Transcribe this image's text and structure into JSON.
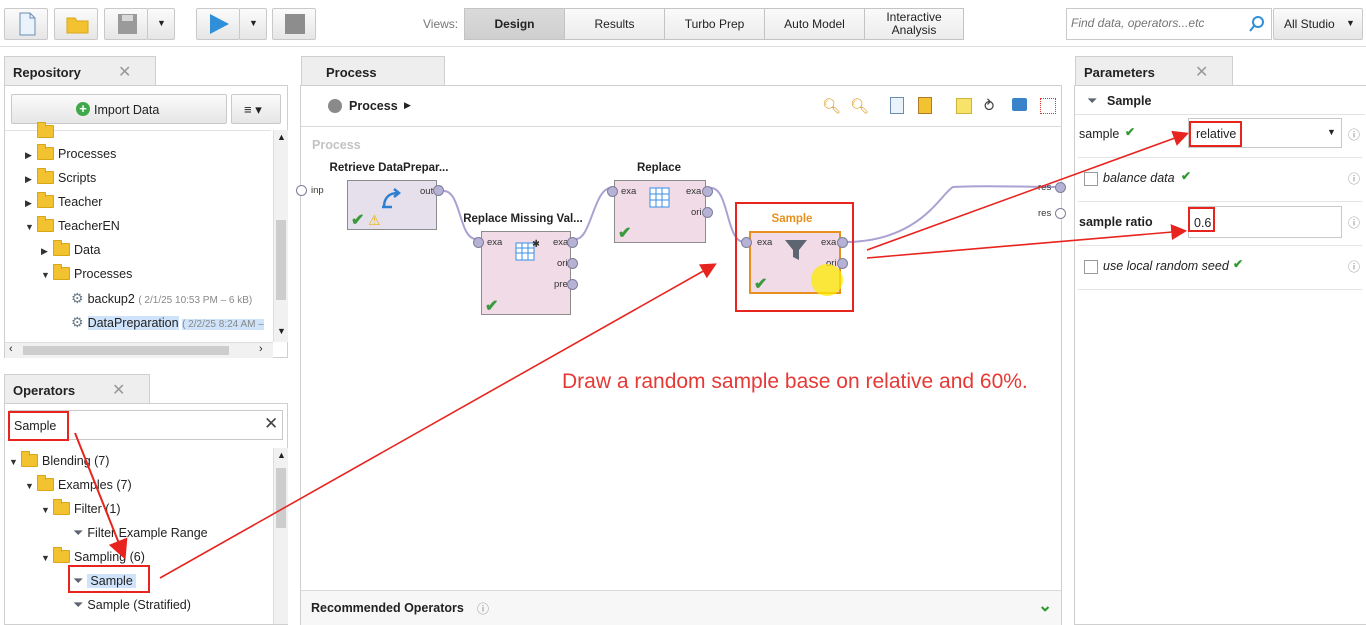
{
  "toolbar": {
    "views_label": "Views:",
    "views": [
      {
        "label": "Design",
        "active": true
      },
      {
        "label": "Results"
      },
      {
        "label": "Turbo Prep"
      },
      {
        "label": "Auto Model"
      },
      {
        "label": "Interactive\nAnalysis"
      }
    ],
    "search_placeholder": "Find data, operators...etc",
    "studio_label": "All Studio"
  },
  "repository": {
    "tab_label": "Repository",
    "import_label": "Import Data",
    "items": [
      {
        "label": "Processes",
        "level": 1
      },
      {
        "label": "Scripts",
        "level": 1
      },
      {
        "label": "Teacher",
        "level": 1
      },
      {
        "label": "TeacherEN",
        "level": 1
      },
      {
        "label": "Data",
        "level": 2
      },
      {
        "label": "Processes",
        "level": 2
      },
      {
        "label": "backup2",
        "meta": "( 2/1/25 10:53 PM – 6 kB)",
        "level": 3
      },
      {
        "label": "DataPreparation",
        "meta": "( 2/2/25 8:24 AM –",
        "level": 3
      }
    ]
  },
  "operators": {
    "tab_label": "Operators",
    "search_value": "Sample",
    "items": [
      {
        "label": "Blending (7)"
      },
      {
        "label": "Examples (7)"
      },
      {
        "label": "Filter (1)"
      },
      {
        "label": "Filter Example Range"
      },
      {
        "label": "Sampling (6)"
      },
      {
        "label": "Sample"
      },
      {
        "label": "Sample (Stratified)"
      }
    ]
  },
  "process": {
    "tab_label": "Process",
    "breadcrumb": "Process",
    "canvas_label": "Process",
    "operators": [
      {
        "title": "Retrieve DataPrepar...",
        "ports_out": [
          "out"
        ]
      },
      {
        "title": "Replace Missing Val...",
        "ports_in": [
          "exa"
        ],
        "ports_out": [
          "exa",
          "ori",
          "pre"
        ]
      },
      {
        "title": "Replace",
        "ports_in": [
          "exa"
        ],
        "ports_out": [
          "exa",
          "ori"
        ]
      },
      {
        "title": "Sample",
        "ports_in": [
          "exa"
        ],
        "ports_out": [
          "exa",
          "ori"
        ]
      }
    ],
    "inp_label": "inp",
    "res_labels": [
      "res",
      "res"
    ],
    "recommended_label": "Recommended Operators"
  },
  "parameters": {
    "tab_label": "Parameters",
    "operator_name": "Sample",
    "sample_label": "sample",
    "sample_value": "relative",
    "balance_label": "balance data",
    "ratio_label": "sample ratio",
    "ratio_value": "0.6",
    "seed_label": "use local random seed"
  },
  "annotation": "Draw a random sample base on relative and 60%.",
  "colors": {
    "accent_red": "#e8241f",
    "operator_purple": "#e6e0ec",
    "operator_pink": "#f0dbe6",
    "sample_border": "#e8901e",
    "check_green": "#3b9a3b"
  }
}
